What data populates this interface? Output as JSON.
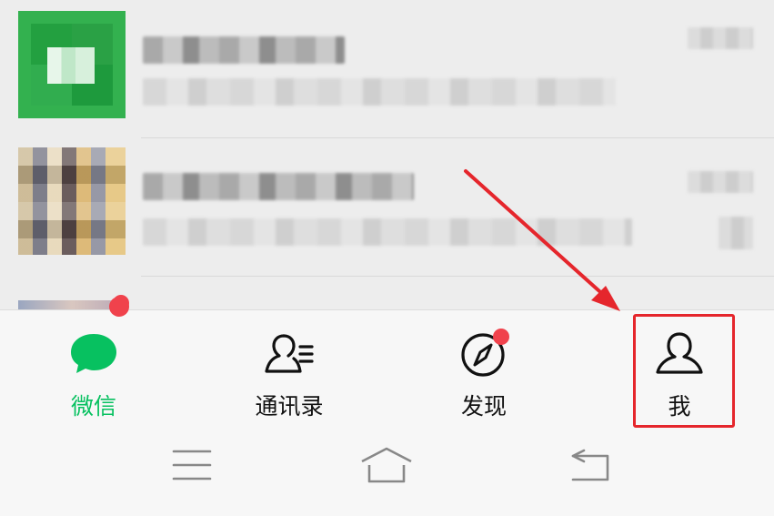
{
  "tabbar": {
    "tabs": [
      {
        "id": "chats",
        "label": "微信",
        "icon": "chat-bubble-icon",
        "active": true
      },
      {
        "id": "contacts",
        "label": "通讯录",
        "icon": "contacts-icon",
        "active": false
      },
      {
        "id": "discover",
        "label": "发现",
        "icon": "compass-icon",
        "active": false,
        "badge_dot": true
      },
      {
        "id": "me",
        "label": "我",
        "icon": "person-icon",
        "active": false,
        "highlighted": true
      }
    ]
  },
  "system_nav": {
    "buttons": [
      "menu-icon",
      "home-icon",
      "back-icon"
    ]
  },
  "colors": {
    "active_tab": "#07c160",
    "badge": "#f0424c",
    "annotation": "#e5262c"
  }
}
